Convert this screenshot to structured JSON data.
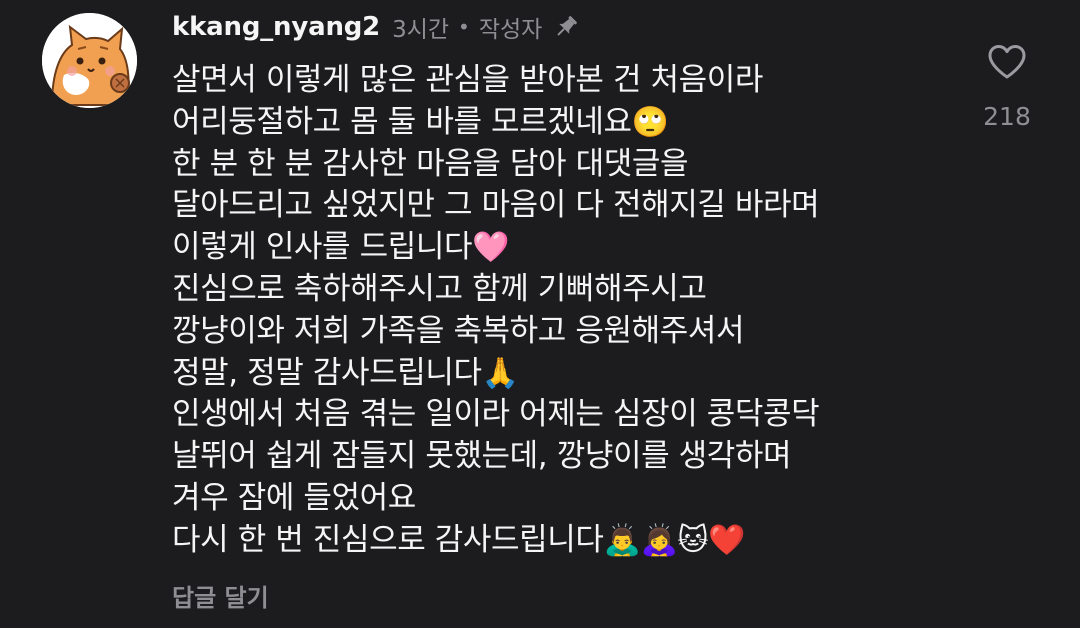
{
  "comment": {
    "username": "kkang_nyang2",
    "time": "3시간",
    "separator": "•",
    "role": "작성자",
    "pin_icon": "pin-icon",
    "lines": [
      {
        "text": "살면서 이렇게 많은 관심을 받아본 건 처음이라",
        "emoji": ""
      },
      {
        "text": "어리둥절하고 몸 둘 바를 모르겠네요",
        "emoji": "🙄"
      },
      {
        "text": "한 분 한 분 감사한 마음을 담아 대댓글을",
        "emoji": ""
      },
      {
        "text": "달아드리고 싶었지만 그 마음이 다 전해지길 바라며",
        "emoji": ""
      },
      {
        "text": "이렇게 인사를 드립니다",
        "emoji": "🩷"
      },
      {
        "text": "진심으로 축하해주시고 함께 기뻐해주시고",
        "emoji": ""
      },
      {
        "text": "깡냥이와 저희 가족을 축복하고 응원해주셔서",
        "emoji": ""
      },
      {
        "text": "정말, 정말 감사드립니다",
        "emoji": "🙏"
      },
      {
        "text": "인생에서 처음 겪는 일이라 어제는 심장이 콩닥콩닥",
        "emoji": ""
      },
      {
        "text": "날뛰어 쉽게 잠들지 못했는데, 깡냥이를 생각하며",
        "emoji": ""
      },
      {
        "text": "겨우 잠에 들었어요",
        "emoji": ""
      },
      {
        "text": "다시 한 번 진심으로 감사드립니다",
        "emoji": "🙇‍♂️🙇‍♀️🐱❤️"
      }
    ],
    "reply_label": "답글 달기",
    "like_count": "218",
    "like_icon": "heart-icon"
  }
}
